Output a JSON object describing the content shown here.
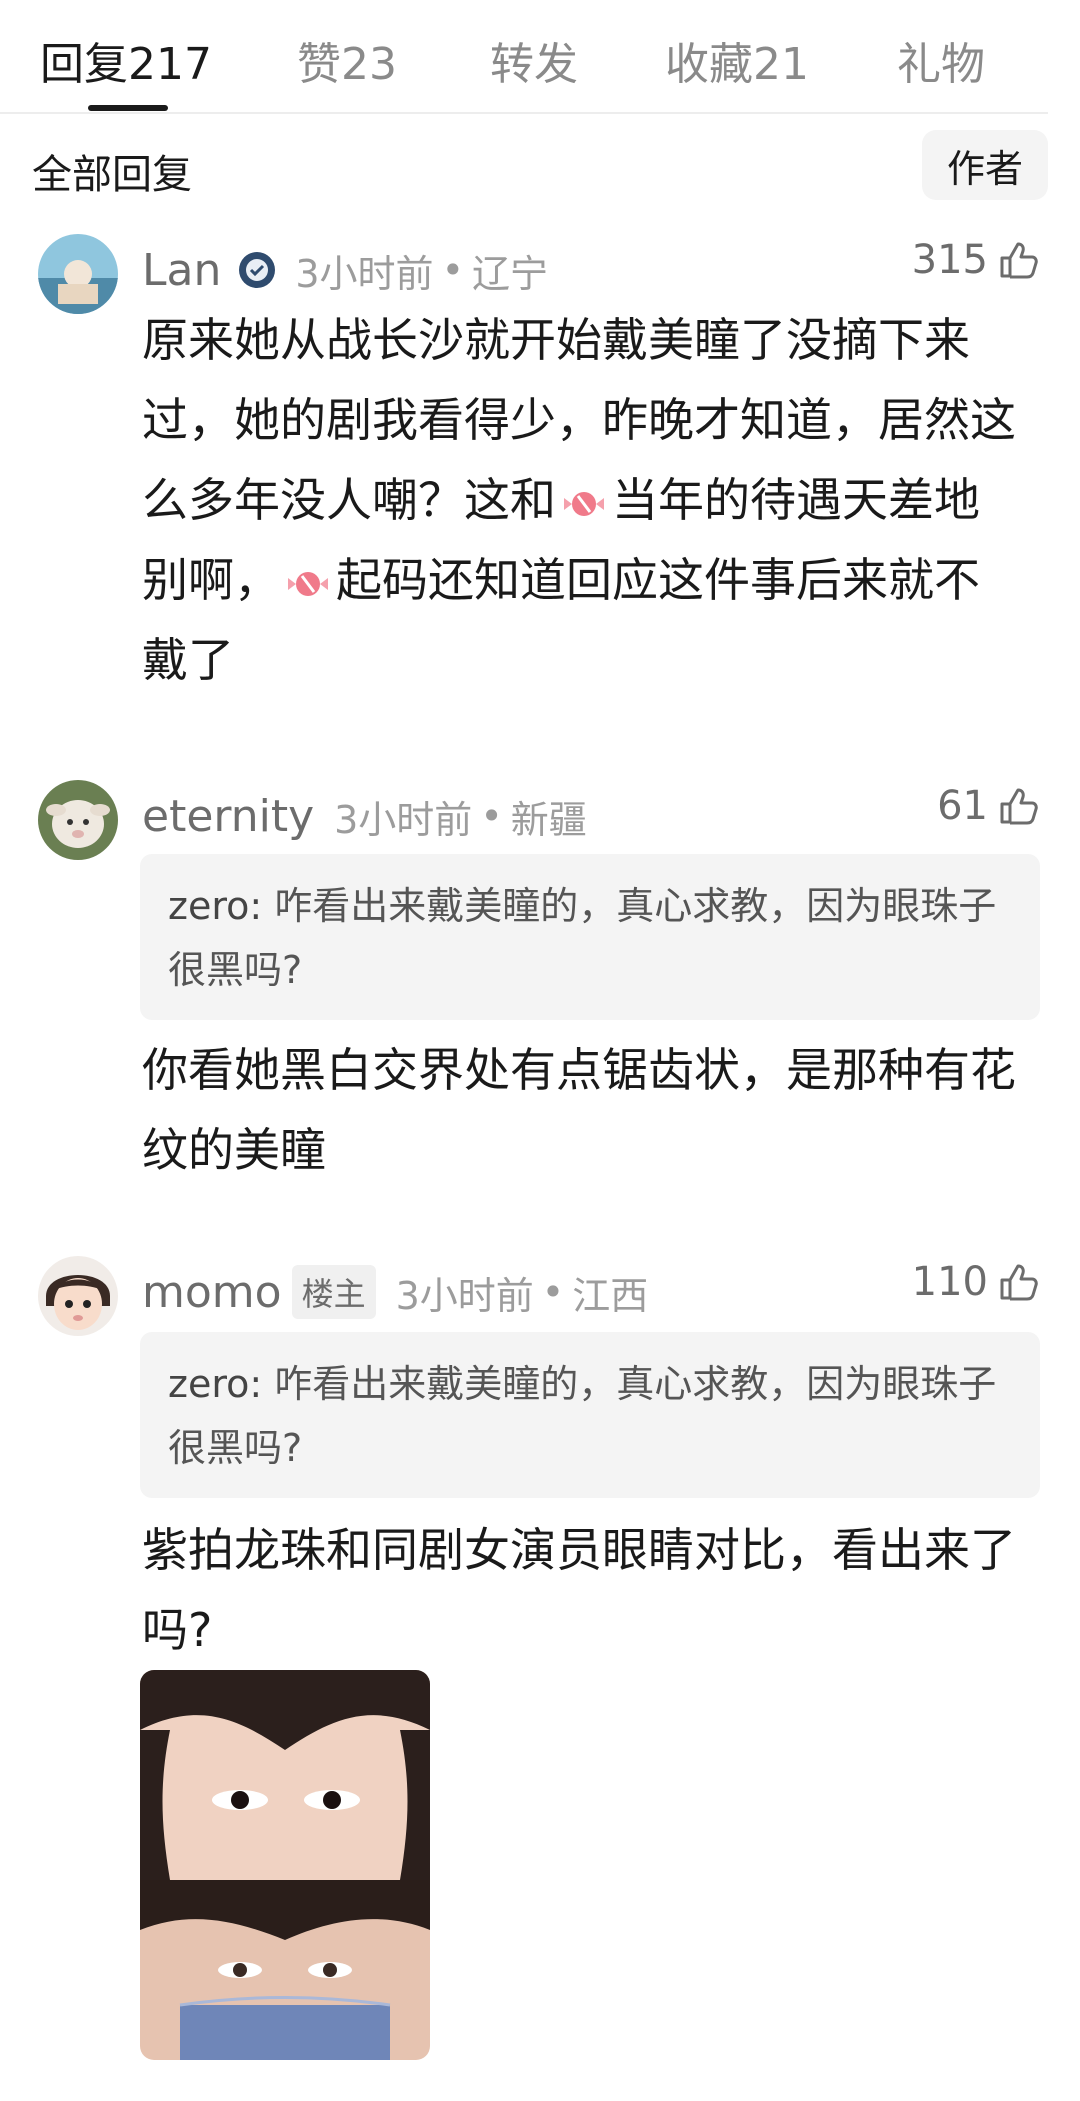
{
  "tabs": [
    {
      "label": "回复",
      "count": "217"
    },
    {
      "label": "赞",
      "count": "23"
    },
    {
      "label": "转发",
      "count": ""
    },
    {
      "label": "收藏",
      "count": "21"
    },
    {
      "label": "礼物",
      "count": ""
    }
  ],
  "filter": {
    "all_label": "全部回复",
    "author_label": "作者"
  },
  "comments": [
    {
      "user": "Lan",
      "time": "3小时前",
      "location": "辽宁",
      "likes": "315",
      "text_parts": [
        "原来她从战长沙就开始戴美瞳了没摘下来过，她的剧我看得少，昨晚才知道，居然这么多年没人嘲？这和",
        "当年的待遇天差地别啊，",
        "起码还知道回应这件事后来就不戴了"
      ]
    },
    {
      "user": "eternity",
      "time": "3小时前",
      "location": "新疆",
      "likes": "61",
      "quote_user": "zero:",
      "quote_text": "咋看出来戴美瞳的，真心求教，因为眼珠子很黑吗?",
      "text": "你看她黑白交界处有点锯齿状，是那种有花纹的美瞳"
    },
    {
      "user": "momo",
      "badge": "楼主",
      "time": "3小时前",
      "location": "江西",
      "likes": "110",
      "quote_user": "zero:",
      "quote_text": "咋看出来戴美瞳的，真心求教，因为眼珠子很黑吗?",
      "text": "紫拍龙珠和同剧女演员眼睛对比，看出来了吗?"
    }
  ],
  "icons": {
    "like": "thumbs-up-icon",
    "candy": "candy-emoji-icon",
    "verified": "verified-badge-icon"
  },
  "colors": {
    "accent": "#1a1a1a",
    "muted": "#9c9c9c",
    "quote_bg": "#f4f4f4"
  }
}
